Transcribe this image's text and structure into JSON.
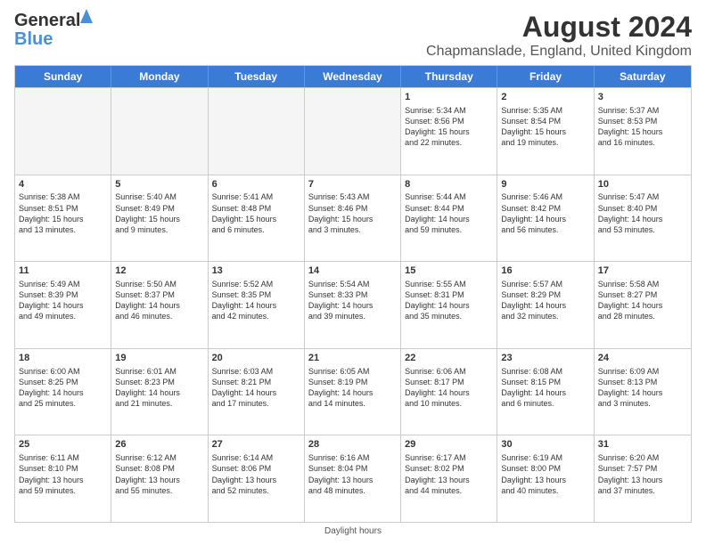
{
  "logo": {
    "line1": "General",
    "line2": "Blue"
  },
  "title": "August 2024",
  "subtitle": "Chapmanslade, England, United Kingdom",
  "days": [
    "Sunday",
    "Monday",
    "Tuesday",
    "Wednesday",
    "Thursday",
    "Friday",
    "Saturday"
  ],
  "footer": "Daylight hours",
  "weeks": [
    [
      {
        "day": "",
        "detail": "",
        "shaded": true
      },
      {
        "day": "",
        "detail": "",
        "shaded": true
      },
      {
        "day": "",
        "detail": "",
        "shaded": true
      },
      {
        "day": "",
        "detail": "",
        "shaded": true
      },
      {
        "day": "1",
        "detail": "Sunrise: 5:34 AM\nSunset: 8:56 PM\nDaylight: 15 hours\nand 22 minutes."
      },
      {
        "day": "2",
        "detail": "Sunrise: 5:35 AM\nSunset: 8:54 PM\nDaylight: 15 hours\nand 19 minutes."
      },
      {
        "day": "3",
        "detail": "Sunrise: 5:37 AM\nSunset: 8:53 PM\nDaylight: 15 hours\nand 16 minutes."
      }
    ],
    [
      {
        "day": "4",
        "detail": "Sunrise: 5:38 AM\nSunset: 8:51 PM\nDaylight: 15 hours\nand 13 minutes."
      },
      {
        "day": "5",
        "detail": "Sunrise: 5:40 AM\nSunset: 8:49 PM\nDaylight: 15 hours\nand 9 minutes."
      },
      {
        "day": "6",
        "detail": "Sunrise: 5:41 AM\nSunset: 8:48 PM\nDaylight: 15 hours\nand 6 minutes."
      },
      {
        "day": "7",
        "detail": "Sunrise: 5:43 AM\nSunset: 8:46 PM\nDaylight: 15 hours\nand 3 minutes."
      },
      {
        "day": "8",
        "detail": "Sunrise: 5:44 AM\nSunset: 8:44 PM\nDaylight: 14 hours\nand 59 minutes."
      },
      {
        "day": "9",
        "detail": "Sunrise: 5:46 AM\nSunset: 8:42 PM\nDaylight: 14 hours\nand 56 minutes."
      },
      {
        "day": "10",
        "detail": "Sunrise: 5:47 AM\nSunset: 8:40 PM\nDaylight: 14 hours\nand 53 minutes."
      }
    ],
    [
      {
        "day": "11",
        "detail": "Sunrise: 5:49 AM\nSunset: 8:39 PM\nDaylight: 14 hours\nand 49 minutes."
      },
      {
        "day": "12",
        "detail": "Sunrise: 5:50 AM\nSunset: 8:37 PM\nDaylight: 14 hours\nand 46 minutes."
      },
      {
        "day": "13",
        "detail": "Sunrise: 5:52 AM\nSunset: 8:35 PM\nDaylight: 14 hours\nand 42 minutes."
      },
      {
        "day": "14",
        "detail": "Sunrise: 5:54 AM\nSunset: 8:33 PM\nDaylight: 14 hours\nand 39 minutes."
      },
      {
        "day": "15",
        "detail": "Sunrise: 5:55 AM\nSunset: 8:31 PM\nDaylight: 14 hours\nand 35 minutes."
      },
      {
        "day": "16",
        "detail": "Sunrise: 5:57 AM\nSunset: 8:29 PM\nDaylight: 14 hours\nand 32 minutes."
      },
      {
        "day": "17",
        "detail": "Sunrise: 5:58 AM\nSunset: 8:27 PM\nDaylight: 14 hours\nand 28 minutes."
      }
    ],
    [
      {
        "day": "18",
        "detail": "Sunrise: 6:00 AM\nSunset: 8:25 PM\nDaylight: 14 hours\nand 25 minutes."
      },
      {
        "day": "19",
        "detail": "Sunrise: 6:01 AM\nSunset: 8:23 PM\nDaylight: 14 hours\nand 21 minutes."
      },
      {
        "day": "20",
        "detail": "Sunrise: 6:03 AM\nSunset: 8:21 PM\nDaylight: 14 hours\nand 17 minutes."
      },
      {
        "day": "21",
        "detail": "Sunrise: 6:05 AM\nSunset: 8:19 PM\nDaylight: 14 hours\nand 14 minutes."
      },
      {
        "day": "22",
        "detail": "Sunrise: 6:06 AM\nSunset: 8:17 PM\nDaylight: 14 hours\nand 10 minutes."
      },
      {
        "day": "23",
        "detail": "Sunrise: 6:08 AM\nSunset: 8:15 PM\nDaylight: 14 hours\nand 6 minutes."
      },
      {
        "day": "24",
        "detail": "Sunrise: 6:09 AM\nSunset: 8:13 PM\nDaylight: 14 hours\nand 3 minutes."
      }
    ],
    [
      {
        "day": "25",
        "detail": "Sunrise: 6:11 AM\nSunset: 8:10 PM\nDaylight: 13 hours\nand 59 minutes."
      },
      {
        "day": "26",
        "detail": "Sunrise: 6:12 AM\nSunset: 8:08 PM\nDaylight: 13 hours\nand 55 minutes."
      },
      {
        "day": "27",
        "detail": "Sunrise: 6:14 AM\nSunset: 8:06 PM\nDaylight: 13 hours\nand 52 minutes."
      },
      {
        "day": "28",
        "detail": "Sunrise: 6:16 AM\nSunset: 8:04 PM\nDaylight: 13 hours\nand 48 minutes."
      },
      {
        "day": "29",
        "detail": "Sunrise: 6:17 AM\nSunset: 8:02 PM\nDaylight: 13 hours\nand 44 minutes."
      },
      {
        "day": "30",
        "detail": "Sunrise: 6:19 AM\nSunset: 8:00 PM\nDaylight: 13 hours\nand 40 minutes."
      },
      {
        "day": "31",
        "detail": "Sunrise: 6:20 AM\nSunset: 7:57 PM\nDaylight: 13 hours\nand 37 minutes."
      }
    ]
  ]
}
